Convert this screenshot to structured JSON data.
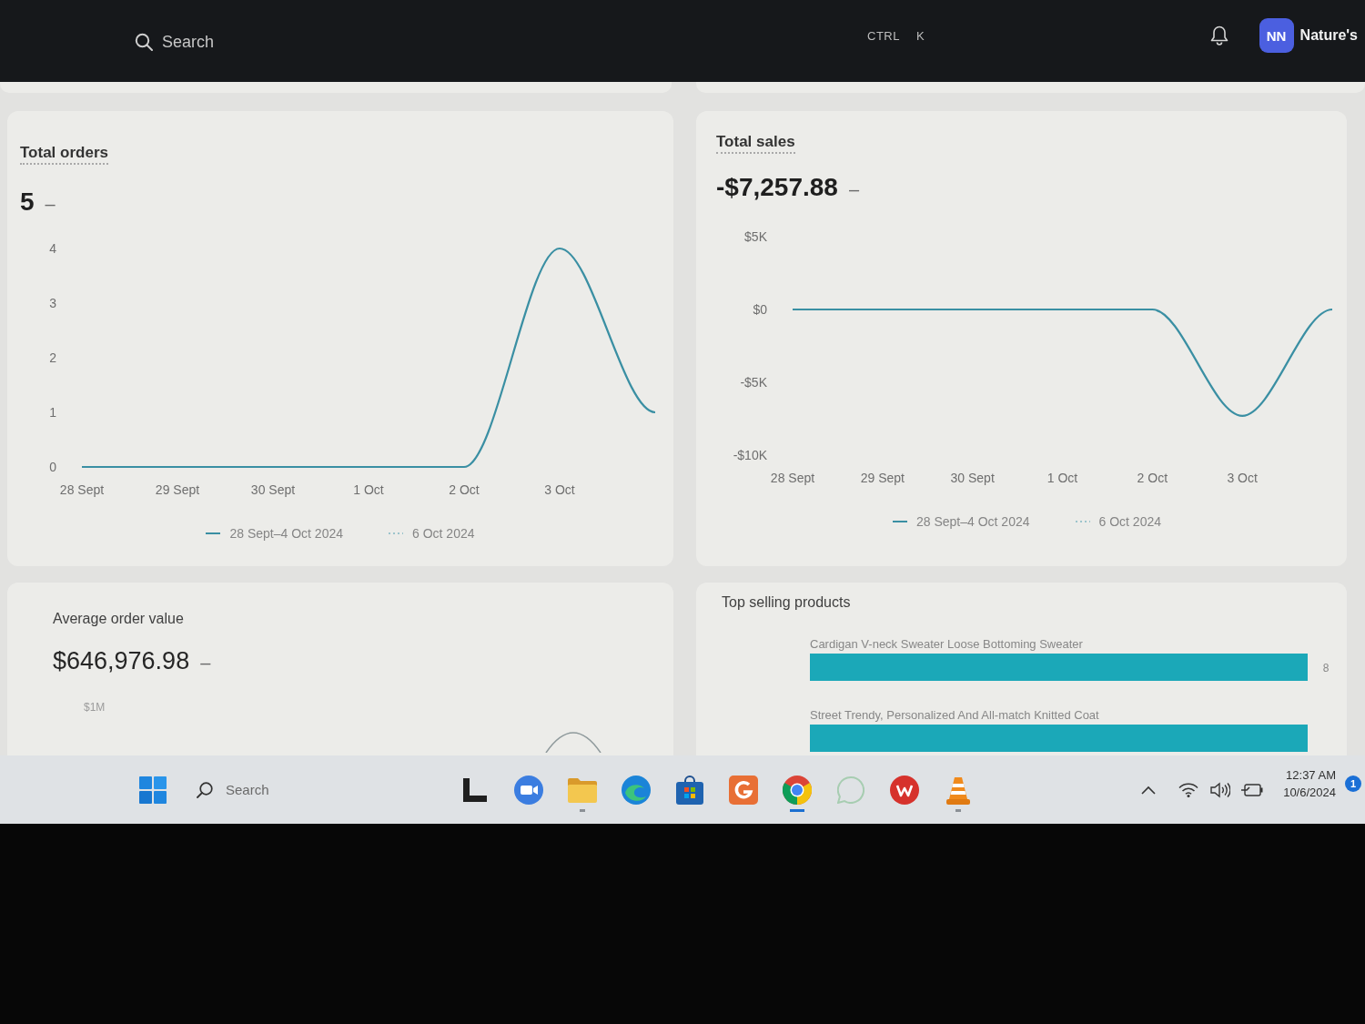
{
  "top_bar": {
    "search": {
      "placeholder": "Search"
    },
    "shortcut_keys": [
      "CTRL",
      "K"
    ],
    "avatar": "NN",
    "store_name": "Nature's"
  },
  "cards": [
    {
      "kind": "line",
      "title": "Total orders",
      "value": "5",
      "change": "–",
      "chart_data": {
        "type": "line",
        "categories": [
          "28 Sept",
          "29 Sept",
          "30 Sept",
          "1 Oct",
          "2 Oct",
          "3 Oct",
          null
        ],
        "yticks": [
          0,
          1,
          2,
          3,
          4
        ],
        "ylim": [
          0,
          4
        ],
        "series": [
          {
            "name": "28 Sept–4 Oct 2024",
            "color": "#3a8fa3",
            "values": [
              0,
              0,
              0,
              0,
              0,
              4,
              1
            ]
          },
          {
            "name": "6 Oct 2024",
            "color": "#9cc4cc",
            "line_style": "dotted",
            "values": [
              null,
              null,
              null,
              null,
              null,
              null,
              null
            ]
          }
        ]
      }
    },
    {
      "kind": "line",
      "title": "Total sales",
      "value": "-$7,257.88",
      "change": "–",
      "chart_data": {
        "type": "line",
        "categories": [
          "28 Sept",
          "29 Sept",
          "30 Sept",
          "1 Oct",
          "2 Oct",
          "3 Oct",
          null
        ],
        "yticks": [
          {
            "value": 5000,
            "label": "$5K"
          },
          {
            "value": 0,
            "label": "$0"
          },
          {
            "value": -5000,
            "label": "-$5K"
          },
          {
            "value": -10000,
            "label": "-$10K"
          }
        ],
        "ylim": [
          -10000,
          5000
        ],
        "series": [
          {
            "name": "28 Sept–4 Oct 2024",
            "color": "#3a8fa3",
            "values": [
              0,
              0,
              0,
              0,
              0,
              -7300,
              0
            ]
          },
          {
            "name": "6 Oct 2024",
            "color": "#9cc4cc",
            "line_style": "dotted",
            "values": [
              null,
              null,
              null,
              null,
              null,
              null,
              null
            ]
          }
        ]
      }
    },
    {
      "kind": "preview",
      "title": "Average order value",
      "value": "$646,976.98",
      "change": "–",
      "tick_label": "$1M"
    },
    {
      "kind": "bars",
      "title": "Top selling products",
      "chart_data": {
        "type": "bar",
        "orientation": "horizontal",
        "categories": [
          "Cardigan V-neck Sweater Loose Bottoming Sweater",
          "Street Trendy, Personalized And All-match Knitted Coat"
        ],
        "values": [
          8,
          8
        ],
        "value_labels": [
          "8",
          null
        ],
        "color": "#1ba8b8"
      }
    }
  ],
  "taskbar": {
    "search": {
      "placeholder": "Search"
    },
    "apps": [
      {
        "kind": "block",
        "running": false,
        "selected": false
      },
      {
        "kind": "camera",
        "running": false,
        "selected": false
      },
      {
        "kind": "folder",
        "running": true,
        "selected": false
      },
      {
        "kind": "swirl",
        "running": false,
        "selected": false
      },
      {
        "kind": "bag",
        "running": false,
        "selected": false
      },
      {
        "kind": "tile",
        "running": false,
        "selected": false
      },
      {
        "kind": "ring",
        "running": true,
        "selected": true
      },
      {
        "kind": "chat",
        "running": false,
        "selected": false
      },
      {
        "kind": "zigzag",
        "running": false,
        "selected": false
      },
      {
        "kind": "cone",
        "running": true,
        "selected": false
      }
    ],
    "clock": {
      "time": "12:37 AM",
      "date": "10/6/2024"
    },
    "notification_count": "1"
  }
}
